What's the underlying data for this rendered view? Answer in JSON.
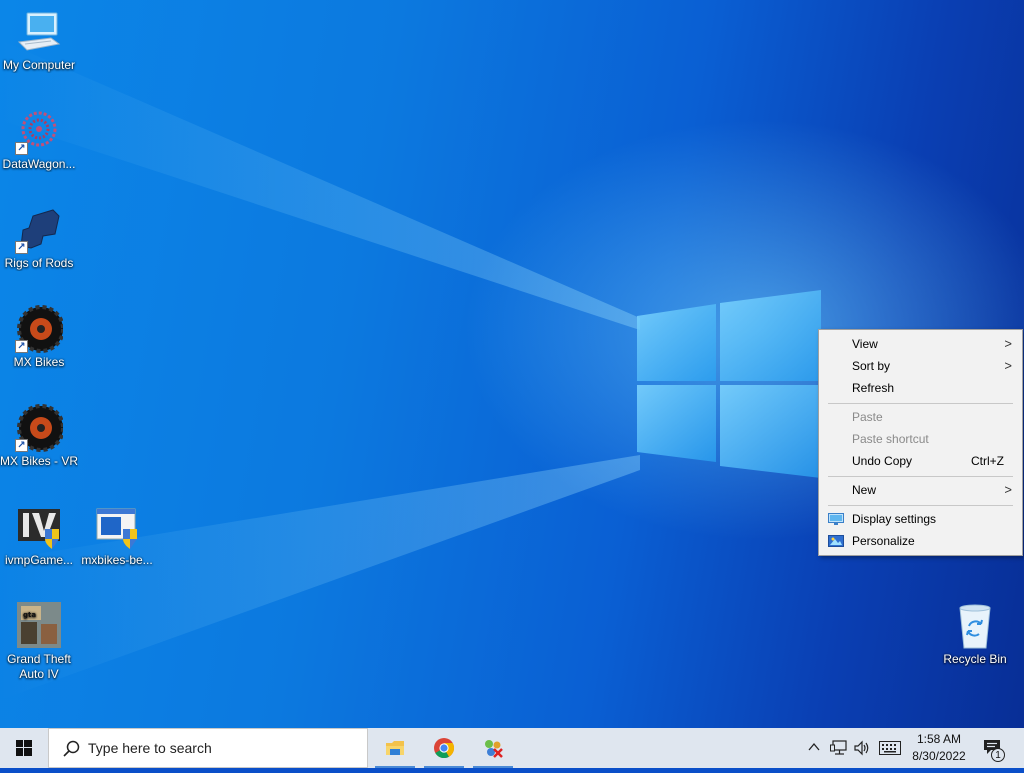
{
  "desktop": {
    "icons": [
      {
        "label": "My Computer"
      },
      {
        "label": "DataWagon..."
      },
      {
        "label": "Rigs of Rods"
      },
      {
        "label": "MX Bikes"
      },
      {
        "label": "MX Bikes - VR"
      },
      {
        "label": "ivmpGame..."
      },
      {
        "label": "mxbikes-be..."
      },
      {
        "label": "Grand Theft Auto IV"
      },
      {
        "label": "Recycle Bin"
      }
    ],
    "shortcut_glyph": "↗"
  },
  "context_menu": {
    "items": [
      {
        "label": "View",
        "submenu": true
      },
      {
        "label": "Sort by",
        "submenu": true
      },
      {
        "label": "Refresh"
      },
      {
        "label": "Paste",
        "disabled": true
      },
      {
        "label": "Paste shortcut",
        "disabled": true
      },
      {
        "label": "Undo Copy",
        "shortcut": "Ctrl+Z"
      },
      {
        "label": "New",
        "submenu": true
      },
      {
        "label": "Display settings",
        "icon": "display-icon"
      },
      {
        "label": "Personalize",
        "icon": "personalize-icon"
      }
    ],
    "arrow_glyph": ">"
  },
  "taskbar": {
    "search_placeholder": "Type here to search",
    "pinned_apps": [
      "File Explorer",
      "Google Chrome",
      "Network app"
    ],
    "clock_time": "1:58 AM",
    "clock_date": "8/30/2022",
    "notification_count": "1",
    "tray_chevron": "^",
    "accent_color": "#4a8ad6"
  }
}
